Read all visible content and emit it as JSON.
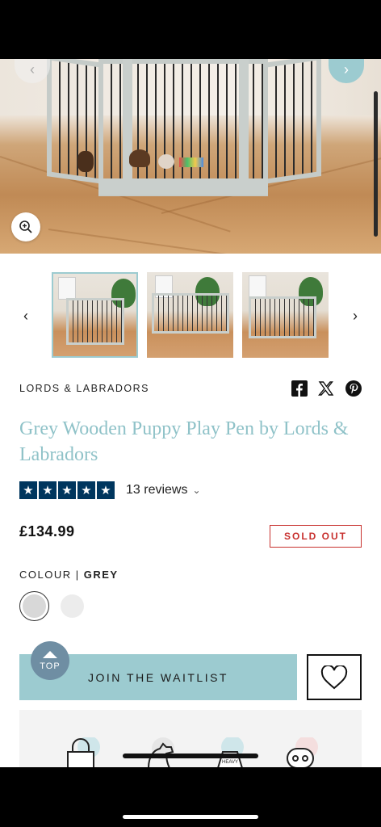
{
  "hero": {
    "icons": {
      "prev": "chevron-left-icon",
      "next": "chevron-right-icon",
      "zoom": "zoom-in-icon"
    }
  },
  "thumbnails": {
    "count": 3,
    "active_index": 0,
    "icons": {
      "prev": "chevron-left-icon",
      "next": "chevron-right-icon"
    }
  },
  "brand": "LORDS & LABRADORS",
  "share": {
    "icons": [
      "facebook-icon",
      "x-icon",
      "pinterest-icon"
    ]
  },
  "product": {
    "title": "Grey Wooden Puppy Play Pen by Lords & Labradors",
    "rating": 5,
    "reviews_label": "13 reviews",
    "price": "£134.99",
    "stock_status": "SOLD OUT"
  },
  "colour": {
    "label": "COLOUR |",
    "selected": "GREY",
    "swatches": [
      "#d8d8d8",
      "#ececec"
    ]
  },
  "actions": {
    "waitlist_label": "JOIN THE WAITLIST",
    "top_label": "TOP",
    "wishlist_icon": "heart-icon"
  },
  "features": {
    "heavy_label": "HEAVY"
  },
  "colors": {
    "accent": "#9ccbd0",
    "title": "#8fc2c8",
    "star_bg": "#00365e",
    "sold_out": "#c8312f"
  }
}
